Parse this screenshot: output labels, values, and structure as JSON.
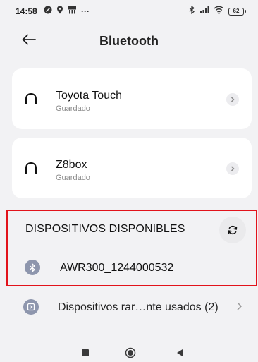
{
  "status_bar": {
    "time": "14:58",
    "notification_more": "···",
    "battery": "62"
  },
  "header": {
    "title": "Bluetooth"
  },
  "saved_devices": [
    {
      "name": "Toyota Touch",
      "status": "Guardado"
    },
    {
      "name": "Z8box",
      "status": "Guardado"
    }
  ],
  "available": {
    "title": "DISPOSITIVOS DISPONIBLES",
    "devices": [
      {
        "name": "AWR300_1244000532"
      }
    ]
  },
  "rarely_used": {
    "label": "Dispositivos rar…nte usados (2)"
  },
  "colors": {
    "highlight_border": "#e2131b",
    "icon_bg": "#8e96ad",
    "card_bg": "#ffffff",
    "page_bg": "#f2f2f4"
  }
}
